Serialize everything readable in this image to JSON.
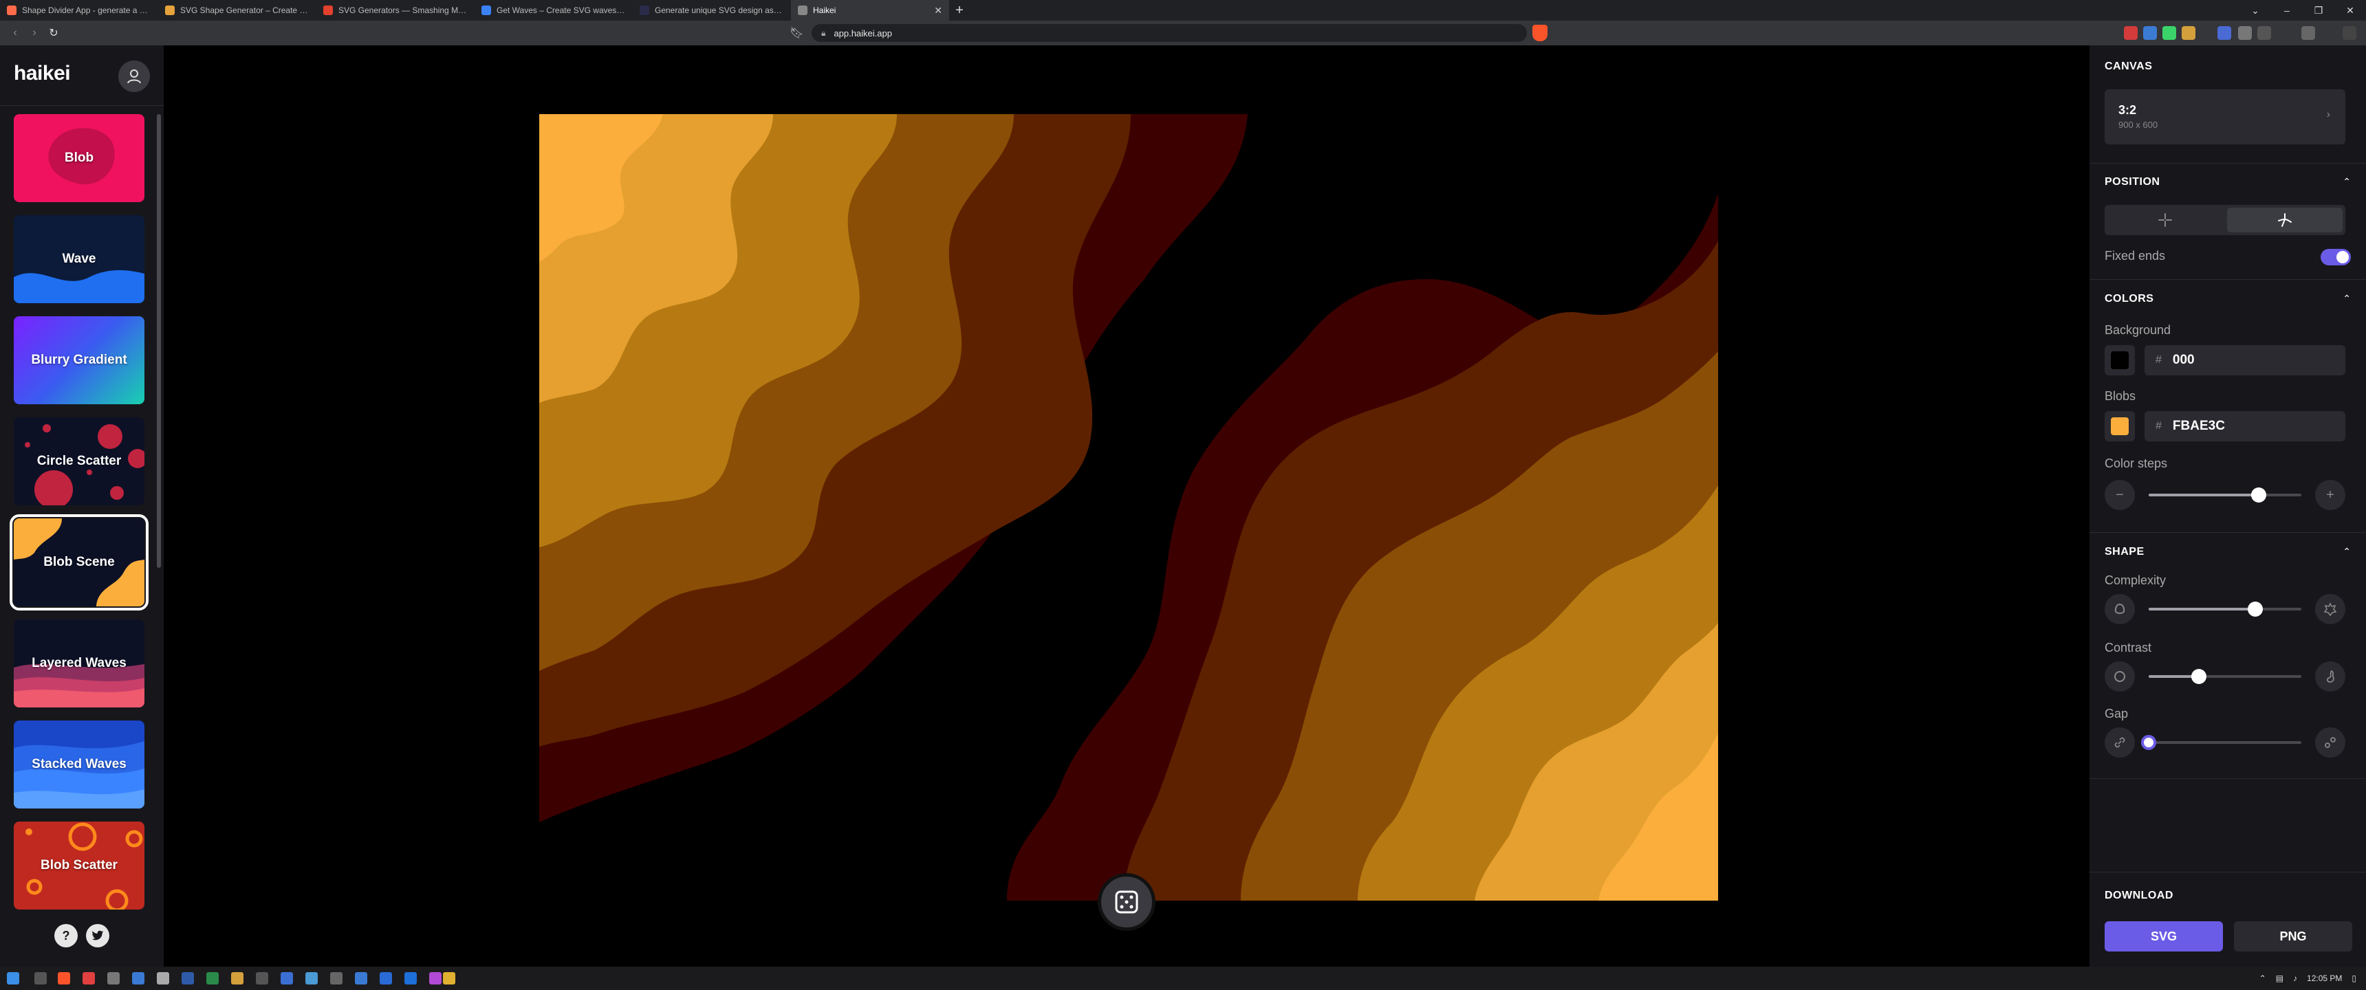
{
  "browser": {
    "tabs": [
      {
        "label": "Shape Divider App - generate a beautif",
        "favicon_color": "#ff6b4a",
        "active": false
      },
      {
        "label": "SVG Shape Generator – Create SVG sh",
        "favicon_color": "#e6a23c",
        "active": false
      },
      {
        "label": "SVG Generators — Smashing Magazin",
        "favicon_color": "#e2412e",
        "active": false
      },
      {
        "label": "Get Waves – Create SVG waves for you",
        "favicon_color": "#3b82f6",
        "active": false
      },
      {
        "label": "Generate unique SVG design assets | H",
        "favicon_color": "#2b2b4a",
        "active": false
      },
      {
        "label": "Haikei",
        "favicon_color": "#888888",
        "active": true
      }
    ],
    "url": "app.haikei.app"
  },
  "app": {
    "logo": "haikei",
    "generators": [
      {
        "label": "Blob"
      },
      {
        "label": "Wave"
      },
      {
        "label": "Blurry Gradient"
      },
      {
        "label": "Circle Scatter"
      },
      {
        "label": "Blob Scene",
        "selected": true
      },
      {
        "label": "Layered Waves"
      },
      {
        "label": "Stacked Waves"
      },
      {
        "label": "Blob Scatter"
      }
    ],
    "footer": {
      "help": "?"
    }
  },
  "panel": {
    "canvas": {
      "title": "CANVAS",
      "ratio": "3:2",
      "dims": "900 x 600"
    },
    "position": {
      "title": "POSITION",
      "fixed_ends_label": "Fixed ends",
      "fixed_ends": true
    },
    "colors": {
      "title": "COLORS",
      "background_label": "Background",
      "background_hex": "000",
      "background_color": "#000000",
      "blobs_label": "Blobs",
      "blobs_hex": "FBAE3C",
      "blobs_color": "#FBAE3C",
      "color_steps_label": "Color steps",
      "color_steps_level": 0.72
    },
    "shape": {
      "title": "SHAPE",
      "complexity_label": "Complexity",
      "complexity_level": 0.7,
      "contrast_label": "Contrast",
      "contrast_level": 0.33,
      "gap_label": "Gap",
      "gap_level": 0.0
    },
    "download": {
      "title": "DOWNLOAD",
      "svg_label": "SVG",
      "png_label": "PNG"
    }
  },
  "scene": {
    "layer_colors": [
      "#3d0000",
      "#5e2100",
      "#8a4e06",
      "#b77a12",
      "#e5a02f",
      "#fbae3c"
    ]
  },
  "taskbar": {
    "time": "12:05 PM"
  }
}
